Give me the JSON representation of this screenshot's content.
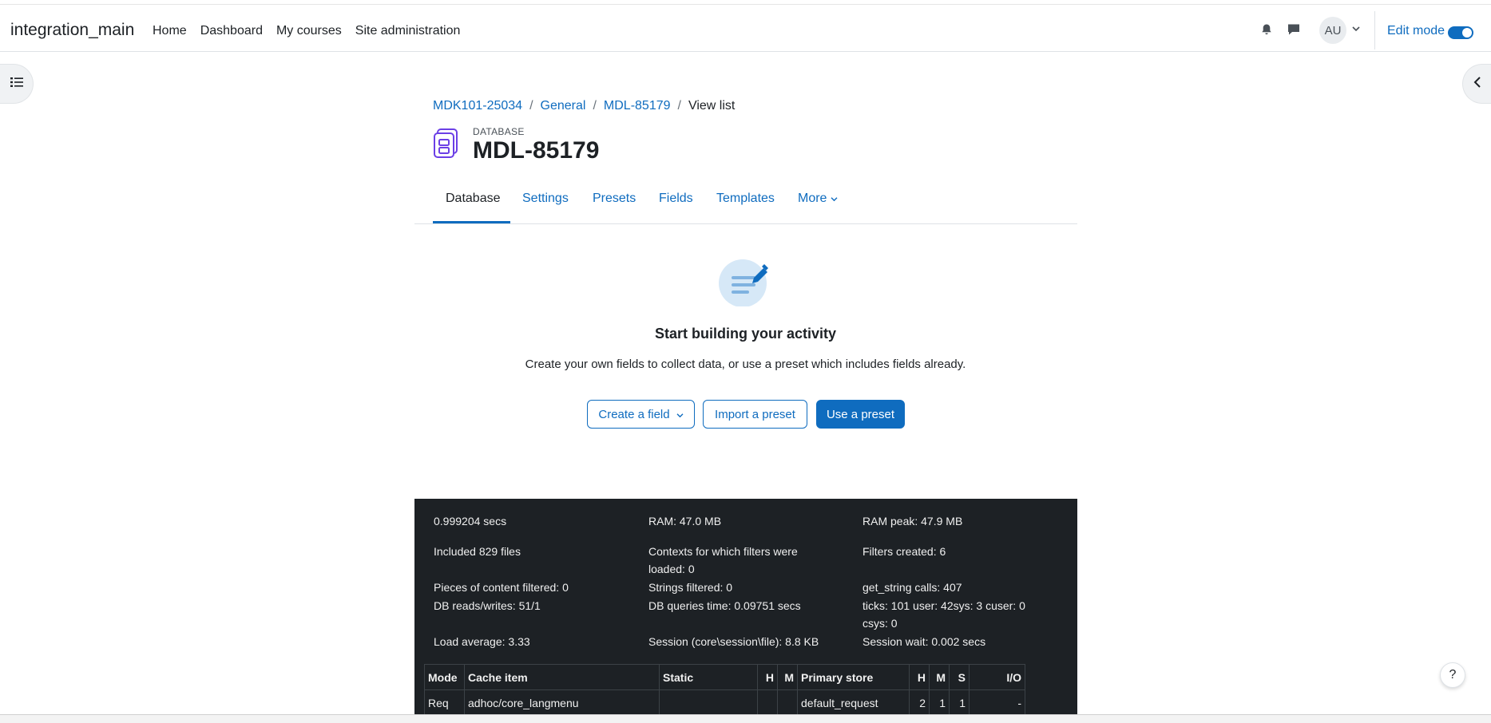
{
  "header": {
    "brand": "integration_main",
    "nav": [
      "Home",
      "Dashboard",
      "My courses",
      "Site administration"
    ],
    "avatar_initials": "AU",
    "edit_mode_label": "Edit mode",
    "edit_mode_on": true,
    "accent": "#0f6cbf"
  },
  "breadcrumb": {
    "items": [
      "MDK101-25034",
      "General",
      "MDL-85179"
    ],
    "current": "View list"
  },
  "activity": {
    "type": "DATABASE",
    "title": "MDL-85179",
    "icon": "database-activity-icon"
  },
  "tabs": [
    "Database",
    "Settings",
    "Presets",
    "Fields",
    "Templates",
    "More"
  ],
  "empty_state": {
    "title": "Start building your activity",
    "description": "Create your own fields to collect data, or use a preset which includes fields already.",
    "buttons": {
      "create_field": "Create a field",
      "import_preset": "Import a preset",
      "use_preset": "Use a preset"
    }
  },
  "perf": {
    "time": "0.999204 secs",
    "ram": "RAM: 47.0 MB",
    "ram_peak": "RAM peak: 47.9 MB",
    "included": "Included 829 files",
    "contexts_1": "Contexts for which filters were",
    "contexts_2": "loaded: 0",
    "filters_created": "Filters created: 6",
    "pieces": "Pieces of content filtered: 0",
    "strings": "Strings filtered: 0",
    "get_string": "get_string calls: 407",
    "db_rw": "DB reads/writes: 51/1",
    "db_time": "DB queries time: 0.09751 secs",
    "ticks_1": "ticks: 101 user: 42sys: 3 cuser: 0",
    "ticks_2": "csys: 0",
    "load": "Load average: 3.33",
    "session": "Session (core\\session\\file): 8.8 KB",
    "session_wait": "Session wait: 0.002 secs"
  },
  "cache_table": {
    "headers": [
      "Mode",
      "Cache item",
      "Static",
      "H",
      "M",
      "Primary store",
      "H",
      "M",
      "S",
      "I/O"
    ],
    "row": [
      "Req",
      "adhoc/core_langmenu",
      "",
      "",
      "",
      "default_request",
      "2",
      "1",
      "1",
      "-"
    ]
  },
  "help_label": "?"
}
